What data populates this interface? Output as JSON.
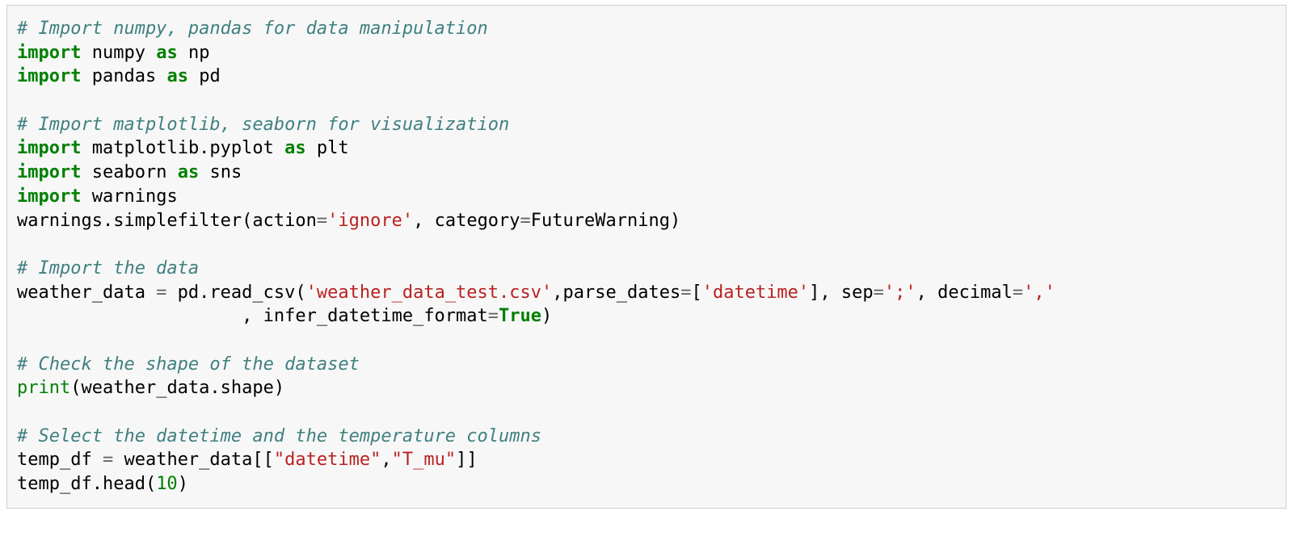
{
  "code": {
    "comment1": "# Import numpy, pandas for data manipulation",
    "kw_import": "import",
    "kw_as": "as",
    "numpy": "numpy",
    "np": "np",
    "pandas": "pandas",
    "pd": "pd",
    "comment2": "# Import matplotlib, seaborn for visualization",
    "mpl": "matplotlib.pyplot",
    "plt": "plt",
    "seaborn": "seaborn",
    "sns": "sns",
    "warnings": "warnings",
    "warnings_call_pre": "warnings.simplefilter(action",
    "eq": "=",
    "str_ignore": "'ignore'",
    "cat_arg": ", category",
    "future": "FutureWarning)",
    "comment3": "# Import the data",
    "wd": "weather_data ",
    "readcsv_pre": " pd.read_csv(",
    "str_csv": "'weather_data_test.csv'",
    "parse_dates": ",parse_dates",
    "eq2": "=",
    "datetime_list_open": "[",
    "str_datetime": "'datetime'",
    "datetime_list_close": "]",
    "sep_arg": ", sep",
    "str_sep": "';'",
    "dec_arg": ", decimal",
    "str_dec": "','",
    "line_cont_indent": "                     , infer_datetime_format",
    "true": "True",
    "close_paren": ")",
    "comment4": "# Check the shape of the dataset",
    "print": "print",
    "print_arg": "(weather_data.shape)",
    "comment5": "# Select the datetime and the temperature columns",
    "tempdf": "temp_df ",
    "sel_pre": " weather_data[[",
    "str_dt2": "\"datetime\"",
    "comma": ",",
    "str_tmu": "\"T_mu\"",
    "sel_post": "]]",
    "head_pre": "temp_df.head(",
    "ten": "10",
    "head_post": ")"
  }
}
